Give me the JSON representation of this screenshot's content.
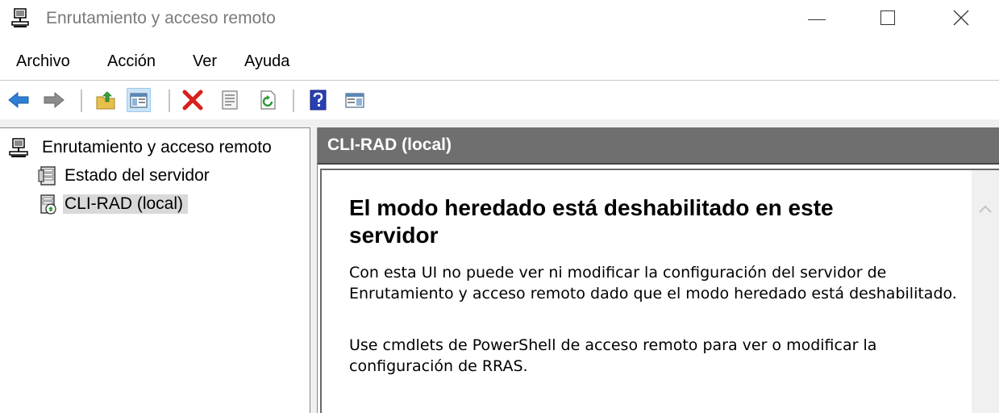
{
  "window": {
    "title": "Enrutamiento y acceso remoto",
    "controls": [
      "minimize",
      "maximize",
      "close"
    ]
  },
  "menu": {
    "items": [
      {
        "label": "Archivo"
      },
      {
        "label": "Acción"
      },
      {
        "label": "Ver"
      },
      {
        "label": "Ayuda"
      }
    ]
  },
  "toolbar": {
    "buttons": [
      {
        "icon": "back-arrow-icon"
      },
      {
        "icon": "forward-arrow-icon"
      },
      {
        "icon": "up-folder-icon"
      },
      {
        "icon": "show-hide-console-tree-icon",
        "pressed": true
      },
      {
        "icon": "delete-icon"
      },
      {
        "icon": "properties-icon"
      },
      {
        "icon": "refresh-icon"
      },
      {
        "icon": "help-icon"
      },
      {
        "icon": "show-action-pane-icon"
      }
    ]
  },
  "tree": {
    "items": [
      {
        "label": "Enrutamiento y acceso remoto",
        "icon": "routing-icon",
        "level": 0
      },
      {
        "label": "Estado del servidor",
        "icon": "server-status-icon",
        "level": 1
      },
      {
        "label": "CLI-RAD (local)",
        "icon": "local-server-icon",
        "level": 1,
        "selected": true
      }
    ]
  },
  "details": {
    "header": "CLI-RAD (local)",
    "heading": "El modo heredado está deshabilitado en este servidor",
    "paragraph1": "Con esta UI no puede ver ni modificar la configuración del servidor de Enrutamiento y acceso remoto dado que el modo heredado está deshabilitado.",
    "paragraph2": "Use cmdlets de PowerShell de acceso remoto para ver o modificar la configuración de RRAS."
  },
  "colors": {
    "header_bar": "#6f6f6f",
    "selection": "#d9d9d9",
    "title_text": "#7a7a7a",
    "delete_red": "#d9201c",
    "arrow_blue": "#2f7fd2"
  }
}
